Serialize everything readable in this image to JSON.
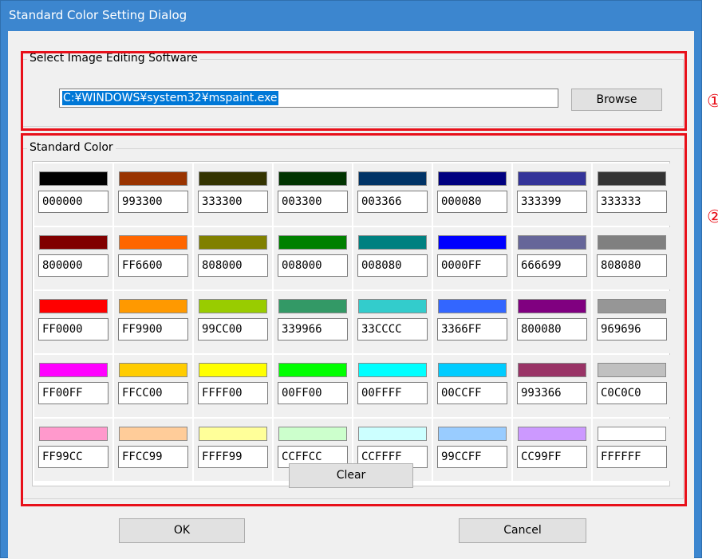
{
  "window": {
    "title": "Standard Color Setting Dialog"
  },
  "software_group": {
    "label": "Select Image Editing Software",
    "path_value": "C:¥WINDOWS¥system32¥mspaint.exe",
    "browse_label": "Browse"
  },
  "color_group": {
    "label": "Standard Color",
    "clear_label": "Clear",
    "colors": [
      "000000",
      "993300",
      "333300",
      "003300",
      "003366",
      "000080",
      "333399",
      "333333",
      "800000",
      "FF6600",
      "808000",
      "008000",
      "008080",
      "0000FF",
      "666699",
      "808080",
      "FF0000",
      "FF9900",
      "99CC00",
      "339966",
      "33CCCC",
      "3366FF",
      "800080",
      "969696",
      "FF00FF",
      "FFCC00",
      "FFFF00",
      "00FF00",
      "00FFFF",
      "00CCFF",
      "993366",
      "C0C0C0",
      "FF99CC",
      "FFCC99",
      "FFFF99",
      "CCFFCC",
      "CCFFFF",
      "99CCFF",
      "CC99FF",
      "FFFFFF"
    ]
  },
  "footer": {
    "ok_label": "OK",
    "cancel_label": "Cancel"
  },
  "annotations": {
    "marker_1": "①",
    "marker_2": "②"
  },
  "accent_colors": {
    "title_bar": "#3c86cf",
    "highlight": "#e8101a",
    "selection": "#0078d7"
  }
}
